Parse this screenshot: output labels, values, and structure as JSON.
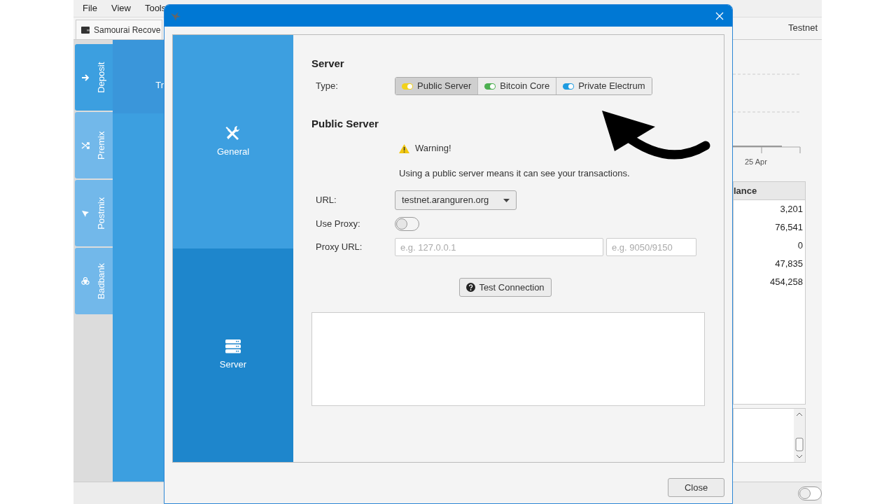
{
  "background_window": {
    "menu": [
      "File",
      "View",
      "Tools"
    ],
    "tab": {
      "label": "Samourai Recove"
    },
    "network": "Testnet",
    "side_tabs": [
      {
        "label": "Deposit",
        "kind": "arrow",
        "selected": true
      },
      {
        "label": "Premix",
        "kind": "shuffle",
        "selected": false
      },
      {
        "label": "Postmix",
        "kind": "send",
        "selected": false
      },
      {
        "label": "Badbank",
        "kind": "biohazard",
        "selected": false
      }
    ],
    "content_fragment": "Tr",
    "chart_label": "25 Apr",
    "table": {
      "column": "lance",
      "rows": [
        "3,201",
        "76,541",
        "0",
        "47,835",
        "454,258"
      ]
    },
    "footer_toggle": {
      "on": false
    }
  },
  "dialog": {
    "nav": [
      {
        "label": "General",
        "kind": "tools",
        "selected": false
      },
      {
        "label": "Server",
        "kind": "server",
        "selected": true
      }
    ],
    "server": {
      "heading": "Server",
      "type_label": "Type:",
      "types": [
        {
          "label": "Public Server",
          "color": "#f2d21b",
          "selected": true
        },
        {
          "label": "Bitcoin Core",
          "color": "#4caf50",
          "selected": false
        },
        {
          "label": "Private Electrum",
          "color": "#1e9be0",
          "selected": false
        }
      ]
    },
    "public_server": {
      "heading": "Public Server",
      "warning": "Warning!",
      "message": "Using a public server means it can see your transactions.",
      "url_label": "URL:",
      "url": "testnet.aranguren.org",
      "proxy_label": "Use Proxy:",
      "use_proxy": false,
      "proxy_url_label": "Proxy URL:",
      "proxy_host_placeholder": "e.g. 127.0.0.1",
      "proxy_port_placeholder": "e.g. 9050/9150",
      "test_button": "Test Connection"
    },
    "close_button": "Close"
  }
}
